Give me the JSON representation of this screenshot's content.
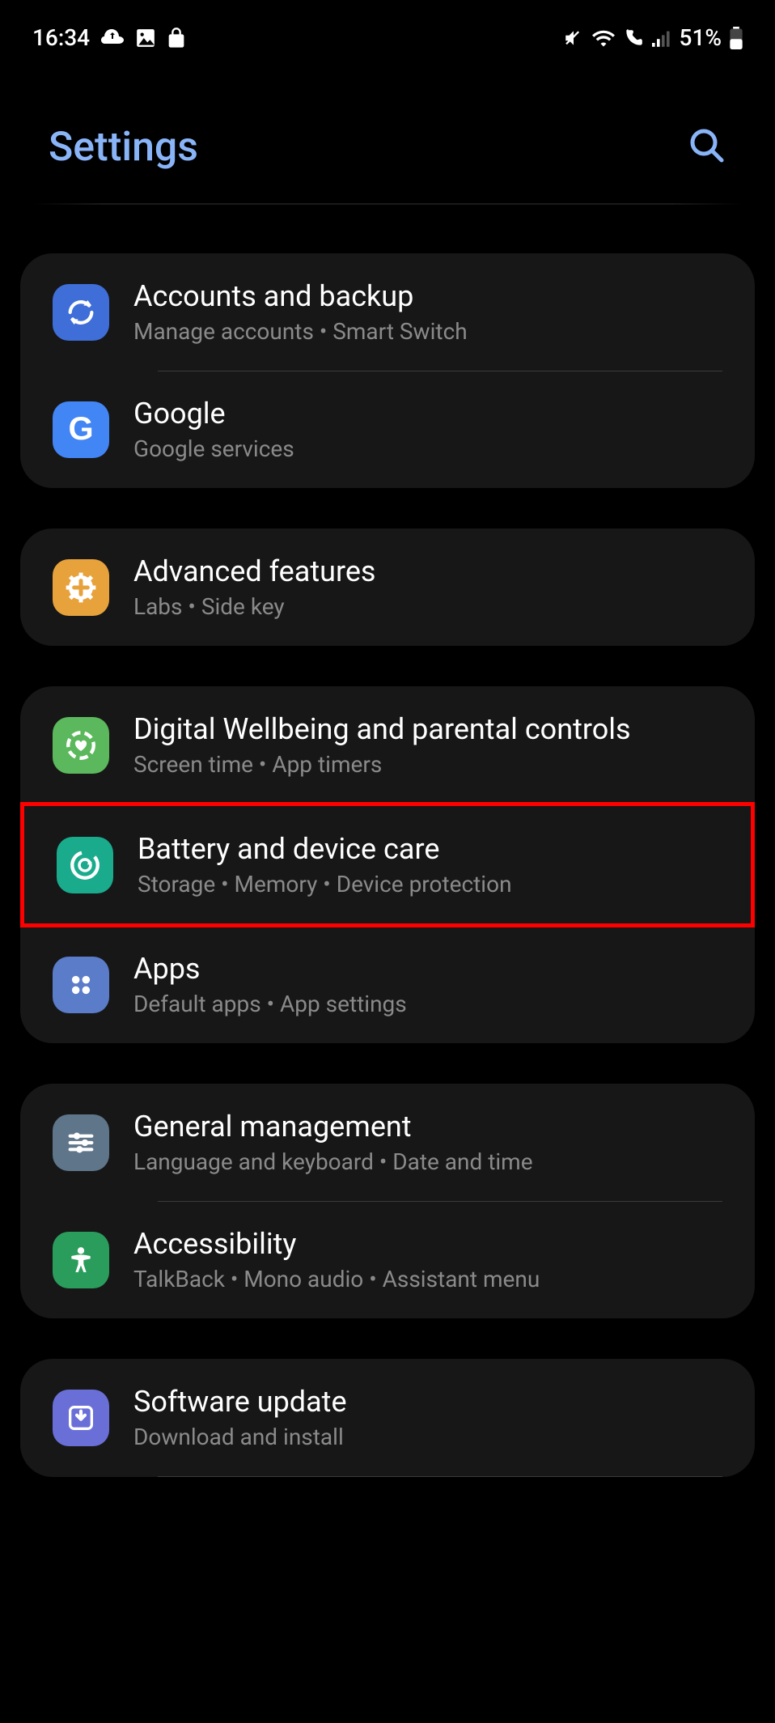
{
  "status": {
    "time": "16:34",
    "battery_pct": "51%"
  },
  "header": {
    "title": "Settings"
  },
  "groups": [
    {
      "items": [
        {
          "id": "accounts",
          "title": "Accounts and backup",
          "sub": "Manage accounts  •  Smart Switch",
          "icon_bg": "bg-blue",
          "icon": "sync-icon"
        },
        {
          "id": "google",
          "title": "Google",
          "sub": "Google services",
          "icon_bg": "bg-gblue",
          "icon": "google-g-icon"
        }
      ]
    },
    {
      "items": [
        {
          "id": "advanced",
          "title": "Advanced features",
          "sub": "Labs  •  Side key",
          "icon_bg": "bg-orange",
          "icon": "plus-gear-icon"
        }
      ]
    },
    {
      "items": [
        {
          "id": "wellbeing",
          "title": "Digital Wellbeing and parental controls",
          "sub": "Screen time  •  App timers",
          "icon_bg": "bg-green",
          "icon": "heart-circle-icon"
        },
        {
          "id": "battery",
          "title": "Battery and device care",
          "sub": "Storage  •  Memory  •  Device protection",
          "icon_bg": "bg-teal",
          "icon": "refresh-circle-icon",
          "highlight": true
        },
        {
          "id": "apps",
          "title": "Apps",
          "sub": "Default apps  •  App settings",
          "icon_bg": "bg-lblue",
          "icon": "four-dots-icon"
        }
      ]
    },
    {
      "items": [
        {
          "id": "general",
          "title": "General management",
          "sub": "Language and keyboard  •  Date and time",
          "icon_bg": "bg-grayblue",
          "icon": "sliders-icon"
        },
        {
          "id": "accessibility",
          "title": "Accessibility",
          "sub": "TalkBack  •  Mono audio  •  Assistant menu",
          "icon_bg": "bg-agreen",
          "icon": "person-icon"
        }
      ]
    },
    {
      "items": [
        {
          "id": "update",
          "title": "Software update",
          "sub": "Download and install",
          "icon_bg": "bg-purple",
          "icon": "download-arrow-icon"
        }
      ]
    }
  ]
}
